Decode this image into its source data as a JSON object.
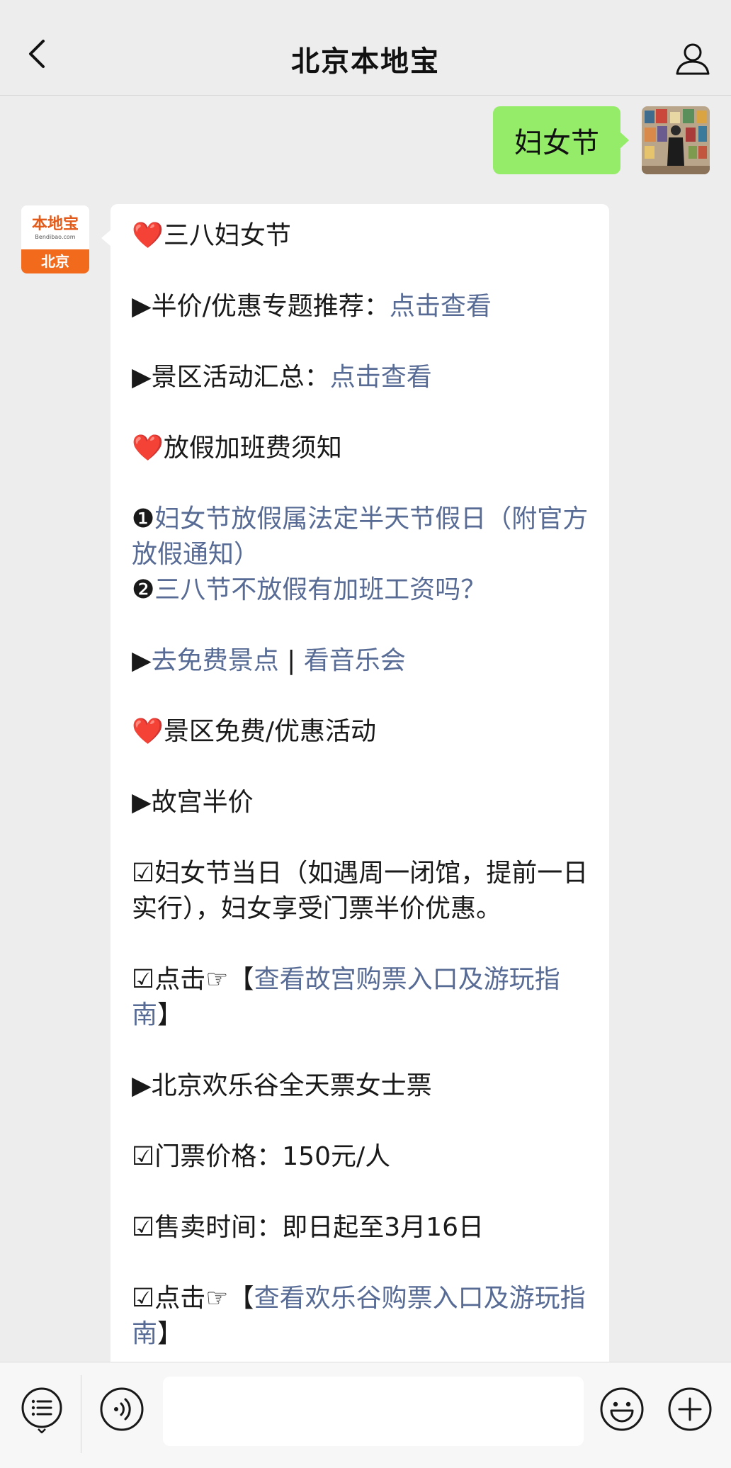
{
  "header": {
    "title": "北京本地宝"
  },
  "sent": {
    "text": "妇女节"
  },
  "bot_avatar": {
    "logo": "本地宝",
    "site": "Bendibao.com",
    "city": "北京"
  },
  "message": {
    "l1_heart": "❤️",
    "l1_text": "三八妇女节",
    "l2_prefix": "▶半价/优惠专题推荐：",
    "l2_link": "点击查看",
    "l3_prefix": "▶景区活动汇总：",
    "l3_link": "点击查看",
    "l4_heart": "❤️",
    "l4_text": "放假加班费须知",
    "l5_bullet": "❶",
    "l5_link": "妇女节放假属法定半天节假日（附官方放假通知）",
    "l6_bullet": "❷",
    "l6_link": "三八节不放假有加班工资吗？",
    "l7_prefix": "▶",
    "l7_link_a": "去免费景点",
    "l7_sep": " | ",
    "l7_link_b": "看音乐会",
    "l8_heart": "❤️",
    "l8_text": "景区免费/优惠活动",
    "l9_text": "▶故宫半价",
    "l10_text": "☑妇女节当日（如遇周一闭馆，提前一日实行），妇女享受门票半价优惠。",
    "l11_prefix": "☑点击☞【",
    "l11_link": "查看故宫购票入口及游玩指南",
    "l11_suffix": "】",
    "l12_text": "▶北京欢乐谷全天票女士票",
    "l13_text": "☑门票价格：150元/人",
    "l14_text": "☑售卖时间：即日起至3月16日",
    "l15_prefix": "☑点击☞【",
    "l15_link": "查看欢乐谷购票入口及游玩指南",
    "l15_suffix": "】"
  },
  "icons": {
    "back": "chevron-left-icon",
    "user": "user-icon",
    "menu": "menu-list-icon",
    "voice": "voice-icon",
    "emoji": "emoji-icon",
    "plus": "plus-icon"
  },
  "colors": {
    "background": "#ededed",
    "sent_bubble": "#95ec69",
    "link": "#576b95",
    "avatar_orange": "#f26b1d"
  }
}
